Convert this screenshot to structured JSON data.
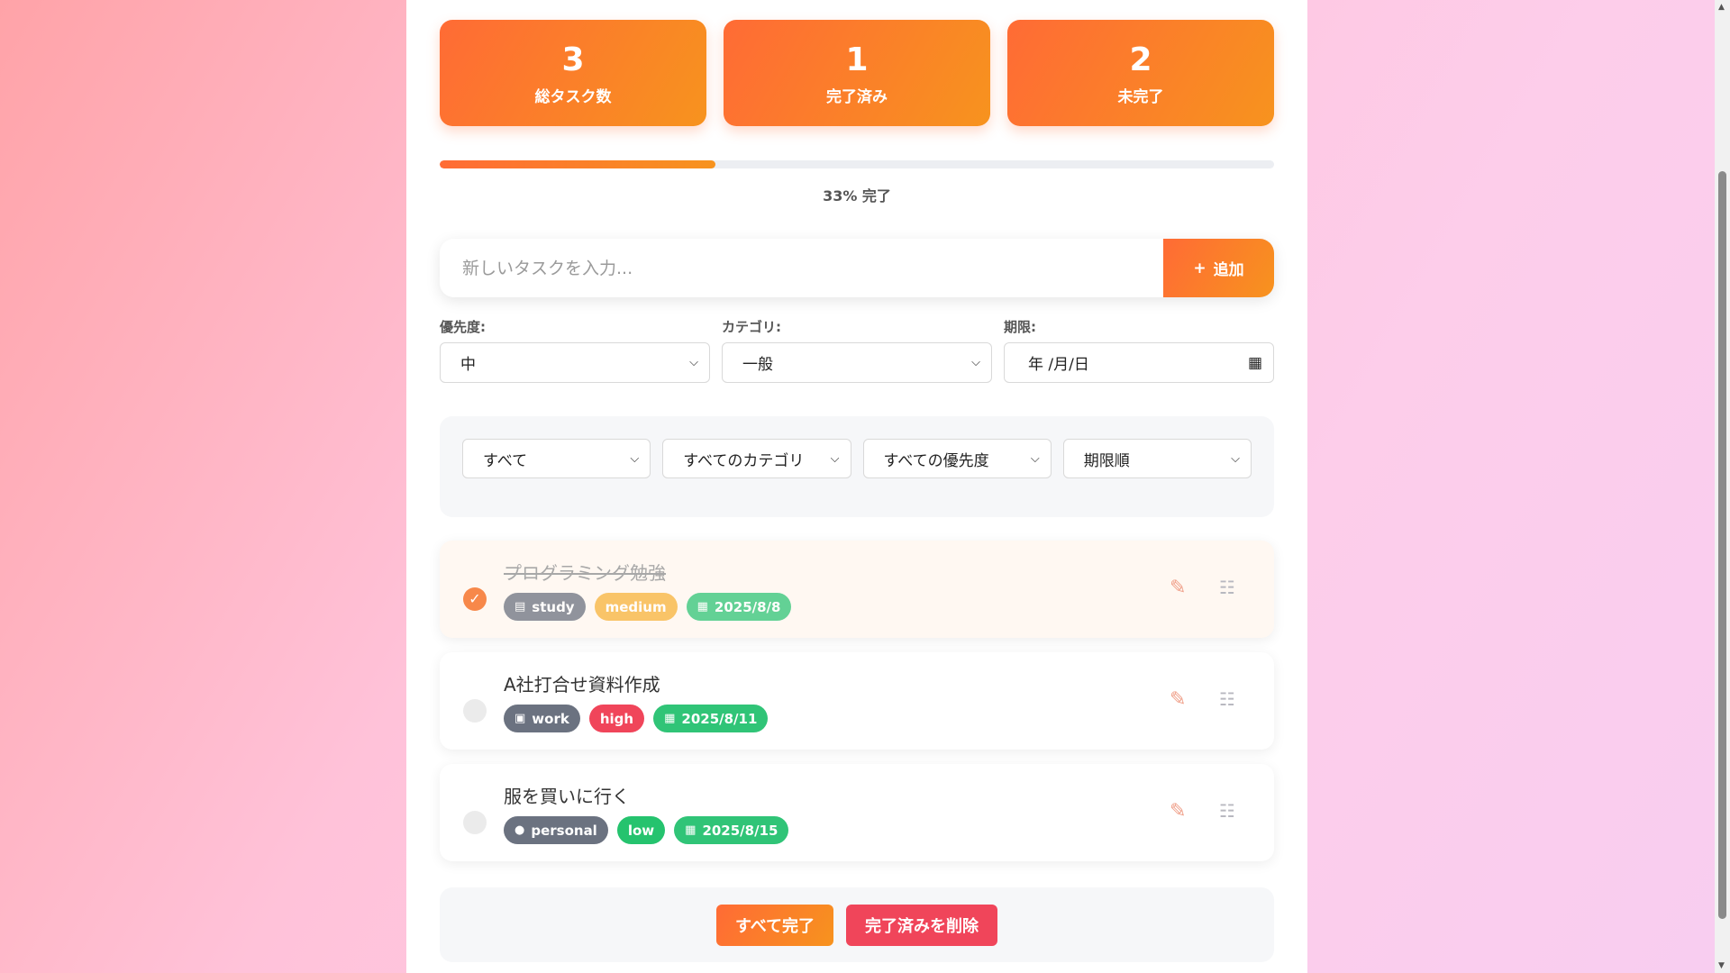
{
  "stats": [
    {
      "value": "3",
      "label": "総タスク数"
    },
    {
      "value": "1",
      "label": "完了済み"
    },
    {
      "value": "2",
      "label": "未完了"
    }
  ],
  "progress": {
    "percent": 33,
    "text": "33% 完了"
  },
  "add": {
    "placeholder": "新しいタスクを入力...",
    "button_label": "追加",
    "button_icon": "+"
  },
  "options": {
    "priority": {
      "label": "優先度:",
      "value": "中"
    },
    "category": {
      "label": "カテゴリ:",
      "value": "一般"
    },
    "due": {
      "label": "期限:",
      "value": "年 /月/日"
    }
  },
  "filters": [
    {
      "value": "すべて"
    },
    {
      "value": "すべてのカテゴリ"
    },
    {
      "value": "すべての優先度"
    },
    {
      "value": "期限順"
    }
  ],
  "tasks": [
    {
      "title": "プログラミング勉強",
      "done": true,
      "category": "study",
      "category_icon": "books-icon",
      "priority": "medium",
      "due": "2025/8/8"
    },
    {
      "title": "A社打合せ資料作成",
      "done": false,
      "category": "work",
      "category_icon": "briefcase-icon",
      "priority": "high",
      "due": "2025/8/11"
    },
    {
      "title": "服を買いに行く",
      "done": false,
      "category": "personal",
      "category_icon": "person-icon",
      "priority": "low",
      "due": "2025/8/15"
    }
  ],
  "bottom": {
    "complete_all": "すべて完了",
    "delete_completed": "完了済みを削除"
  },
  "colors": {
    "accent": "#ff6b35",
    "accent2": "#f7931e",
    "danger": "#f0455a",
    "success": "#25c36e"
  }
}
